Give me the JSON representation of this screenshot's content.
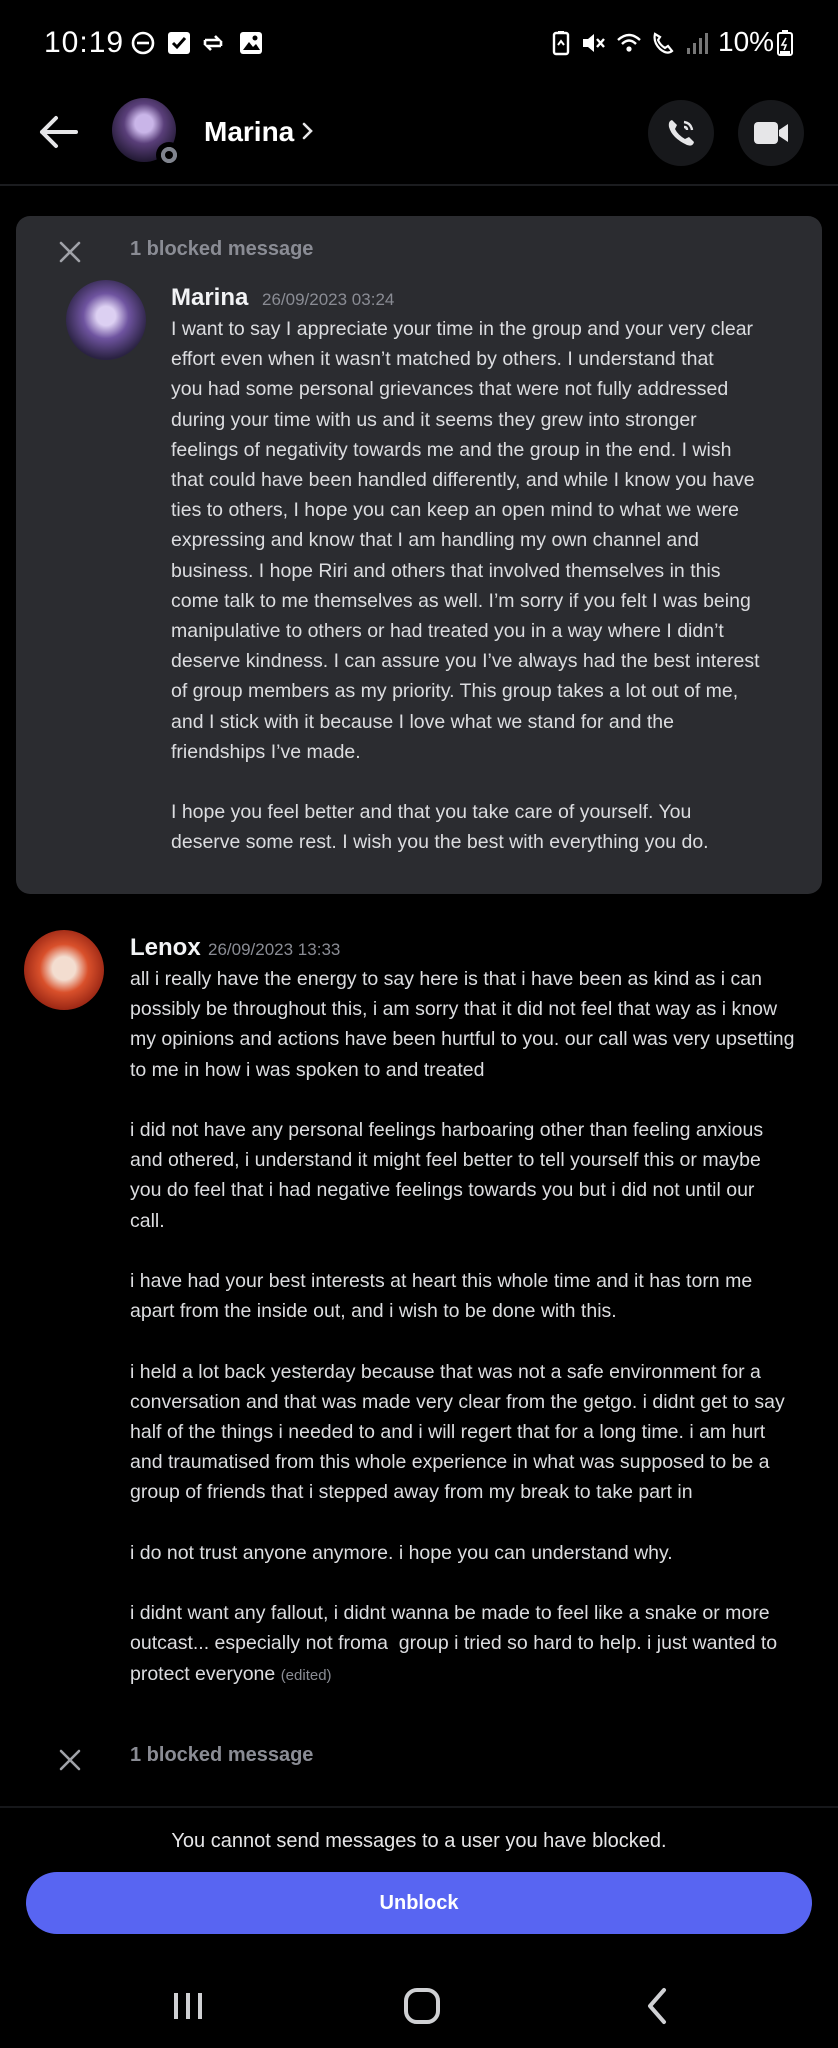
{
  "status_bar": {
    "time": "10:19",
    "battery": "10%"
  },
  "header": {
    "name": "Marina"
  },
  "blocked_message_1": {
    "label": "1 blocked message",
    "author": "Marina",
    "timestamp": "26/09/2023 03:24",
    "text": "I want to say I appreciate your time in the group and your very clear\neffort even when it wasn’t matched by others. I understand that\nyou had some personal grievances that were not fully addressed\nduring your time with us and it seems they grew into stronger\nfeelings of negativity towards me and the group in the end. I wish\nthat could have been handled differently, and while I know you have\nties to others, I hope you can keep an open mind to what we were\nexpressing and know that I am handling my own channel and\nbusiness. I hope Riri and others that involved themselves in this\ncome talk to me themselves as well. I’m sorry if you felt I was being\nmanipulative to others or had treated you in a way where I didn’t\ndeserve kindness. I can assure you I’ve always had the best interest\nof group members as my priority. This group takes a lot out of me,\nand I stick with it because I love what we stand for and the\nfriendships I’ve made.\n\nI hope you feel better and that you take care of yourself. You\ndeserve some rest. I wish you the best with everything you do."
  },
  "message_lenox": {
    "author": "Lenox",
    "timestamp": "26/09/2023 13:33",
    "text": "all i really have the energy to say here is that i have been as kind as i can\npossibly be throughout this, i am sorry that it did not feel that way as i know\nmy opinions and actions have been hurtful to you. our call was very upsetting\nto me in how i was spoken to and treated\n\ni did not have any personal feelings harboaring other than feeling anxious\nand othered, i understand it might feel better to tell yourself this or maybe\nyou do feel that i had negative feelings towards you but i did not until our\ncall.\n\ni have had your best interests at heart this whole time and it has torn me\napart from the inside out, and i wish to be done with this.\n\ni held a lot back yesterday because that was not a safe environment for a\nconversation and that was made very clear from the getgo. i didnt get to say\nhalf of the things i needed to and i will regert that for a long time. i am hurt\nand traumatised from this whole experience in what was supposed to be a\ngroup of friends that i stepped away from my break to take part in\n\ni do not trust anyone anymore. i hope you can understand why.\n\ni didnt want any fallout, i didnt wanna be made to feel like a snake or more\noutcast... especially not froma  group i tried so hard to help. i just wanted to\nprotect everyone",
    "edited": "(edited)"
  },
  "blocked_message_2": {
    "label": "1 blocked message"
  },
  "footer": {
    "cannot_send": "You cannot send messages to a user you have blocked.",
    "unblock_label": "Unblock"
  },
  "colors": {
    "background": "#000000",
    "card": "#2b2c30",
    "accent": "#5865f2",
    "muted": "#8a8c94"
  }
}
